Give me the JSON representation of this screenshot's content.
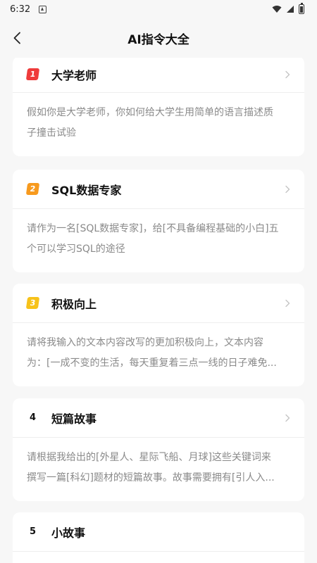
{
  "status_bar": {
    "time": "6:32"
  },
  "nav": {
    "title": "AI指令大全"
  },
  "cards": [
    {
      "rank": "1",
      "title": "大学老师",
      "lines": [
        "假如你是大学老师，你如何给大学生用简单的语言描述质",
        "子撞击试验"
      ]
    },
    {
      "rank": "2",
      "title": "SQL数据专家",
      "lines": [
        "请作为一名[SQL数据专家]，给[不具备编程基础的小白]五",
        "个可以学习SQL的途径"
      ]
    },
    {
      "rank": "3",
      "title": "积极向上",
      "lines": [
        "请将我输入的文本内容改写的更加积极向上，文本内容",
        "为：[一成不变的生活，每天重复着三点一线的日子难免..."
      ]
    },
    {
      "rank": "4",
      "title": "短篇故事",
      "lines": [
        "请根据我给出的[外星人、星际飞船、月球]这些关键词来",
        "撰写一篇[科幻]题材的短篇故事。故事需要拥有[引人入..."
      ]
    },
    {
      "rank": "5",
      "title": "小故事",
      "lines": []
    }
  ],
  "colors": {
    "rank_1": "#ef3b3b",
    "rank_2": "#f79a1e",
    "rank_3": "#f7c21a",
    "page_bg": "#f7f7f7",
    "body_text": "#8a8a8a"
  },
  "icons": {
    "back": "chevron-left-icon",
    "card_arrow": "chevron-right-icon"
  }
}
